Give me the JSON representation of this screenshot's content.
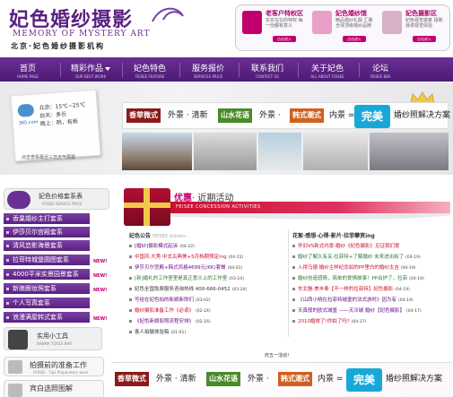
{
  "header": {
    "title": "妃色婚纱摄影",
    "subtitle_en": "MEMORY OF MYSTERY ART",
    "subtitle_cn": "北京·妃色婚纱摄影机构",
    "promos": [
      {
        "title": "老客户特权区",
        "desc": "实实在在的特权 每一份都有意义",
        "btn": "点击进入"
      },
      {
        "title": "妃色婚纱馆",
        "desc": "精品婚纱礼服 汇聚全球顶级婚纱品牌",
        "btn": "点击进入"
      },
      {
        "title": "妃色摄影区",
        "desc": "妃色视觉盛宴 极致浪漫视觉体验",
        "btn": "点击进入"
      }
    ]
  },
  "nav": {
    "items": [
      {
        "zh": "首页",
        "en": "HOME PAGE"
      },
      {
        "zh": "精彩作品",
        "en": "OUR BEST WORK"
      },
      {
        "zh": "妃色特色",
        "en": "FEISEE FEATURE"
      },
      {
        "zh": "服务报价",
        "en": "SERVICES PRICE"
      },
      {
        "zh": "联系我们",
        "en": "CONTACT US"
      },
      {
        "zh": "关于妃色",
        "en": "ALL ABOUT FEISEE"
      },
      {
        "zh": "论坛",
        "en": "FEISEE BBS"
      }
    ]
  },
  "weather": {
    "site": "365.com",
    "city": "北京：15℃~25℃",
    "day": "白天：多云",
    "night": "晚上：阴，有雨",
    "note": "点击查看最近三日天气预报"
  },
  "hero_banner": {
    "tag1": "香草微式",
    "t1": "外景 · 清新",
    "tag2": "山水花语",
    "t2": "外景 · ",
    "tag3": "韩式潮式",
    "t3": "内景 = ",
    "wm": "完美",
    "t4": "婚纱照解决方案",
    "sub": "韩式 潮美"
  },
  "sidebar": {
    "title": "妃色价格套系表",
    "title_en": "FEISEE SERVICE PRICE",
    "items": [
      {
        "label": "香巢婚纱主打套系",
        "new": ""
      },
      {
        "label": "伊莎贝尔宫殿套系",
        "new": ""
      },
      {
        "label": "清风恋影海景套系",
        "new": ""
      },
      {
        "label": "拉菲特城堡圆图套系",
        "new": "NEW!"
      },
      {
        "label": "4000平米实景园景套系",
        "new": "NEW!"
      },
      {
        "label": "新娘跟妆照套系",
        "new": "NEW!"
      },
      {
        "label": "个人写真套系",
        "new": ""
      },
      {
        "label": "浪漫满屋韩式套系",
        "new": "NEW!"
      }
    ],
    "tools_title": "实用小工具",
    "tools_en": "BANMA TOOLS BAR",
    "tools": [
      {
        "title": "拍摄前的准备工作",
        "sub": "FEISEE · Tips Preparatory work"
      },
      {
        "title": "宾白选照图解",
        "sub": ""
      }
    ]
  },
  "concession": {
    "title_a": "优惠",
    "title_b": "· 近期活动",
    "bar": "FEISEE CONCESSION ACTIVITIES"
  },
  "news_left": {
    "head": "妃色公告",
    "head_sub": "FEISEE bulletin...",
    "items": [
      {
        "text": "[婚纱]摄影模式起诉",
        "date": "(04-22)",
        "c": "p"
      },
      {
        "text": "中国风·大秀·中式古典美+5月档期预定ing",
        "date": "(04-15)",
        "c": "r"
      },
      {
        "text": "伊莎贝尔宫殿+韩式风格4699元(KK)套餐",
        "date": "(04-01)",
        "c": "p"
      },
      {
        "text": "[新]婚礼的工作室里是真正意义上的工作室",
        "date": "(03-24)",
        "c": "g"
      },
      {
        "text": "妃色全国免费服务咨询热线 400-666-0452",
        "date": "(03-24)",
        "c": "k"
      },
      {
        "text": "写给在妃色拍的新娘新郎们",
        "date": "(03-02)",
        "c": "p"
      },
      {
        "text": "婚纱摄影准备工作《必读》",
        "date": "(02-24)",
        "c": "r"
      },
      {
        "text": "《妃色新娘影照流程安排》",
        "date": "(02-16)",
        "c": "p"
      },
      {
        "text": "客人拍摄体验稿",
        "date": "(01-01)",
        "c": "k"
      }
    ]
  },
  "news_right": {
    "head": "花絮·感想·心得·影片·拉菲攀赏ing",
    "items": [
      {
        "text": "怀旧VS新式内景·婚纱《妃色摄影》见证我们爱",
        "c": "r"
      },
      {
        "text": "婚纱了解久有关·拉菲特+了解婚纱 未来进出拍了",
        "date": "(04-19)",
        "c": "g"
      },
      {
        "text": "入得马德·婚纱主样纪念如的PP里白的婚纱太吉",
        "date": "(04-19)",
        "c": "r"
      },
      {
        "text": "婚纱创造感情，简单的爱情故事！PP出护了，拉菲",
        "date": "(04-19)",
        "c": "g"
      },
      {
        "text": "东北魅·美丰奉【不一样的拉菲特】妃色摄影",
        "date": "(04-19)",
        "c": "r"
      },
      {
        "text": "《山西小桃在拉菲特城堡的法式游时》因为有",
        "date": "(04-19)",
        "c": "p"
      },
      {
        "text": "天真般的欧式城堡 ——天冷城 婚纱【妃色摄影】",
        "date": "(04-17)",
        "c": "p"
      },
      {
        "text": "2010婚旅了!你拍了吗?",
        "date": "(04-17)",
        "c": "r"
      }
    ]
  },
  "bottom": {
    "head": "庆五一活动！"
  },
  "colors": {
    "brand": "#5a1f80",
    "nav": "#6a2f95",
    "accent": "#c8102e",
    "wedding_cyan": "#18a8d8"
  }
}
